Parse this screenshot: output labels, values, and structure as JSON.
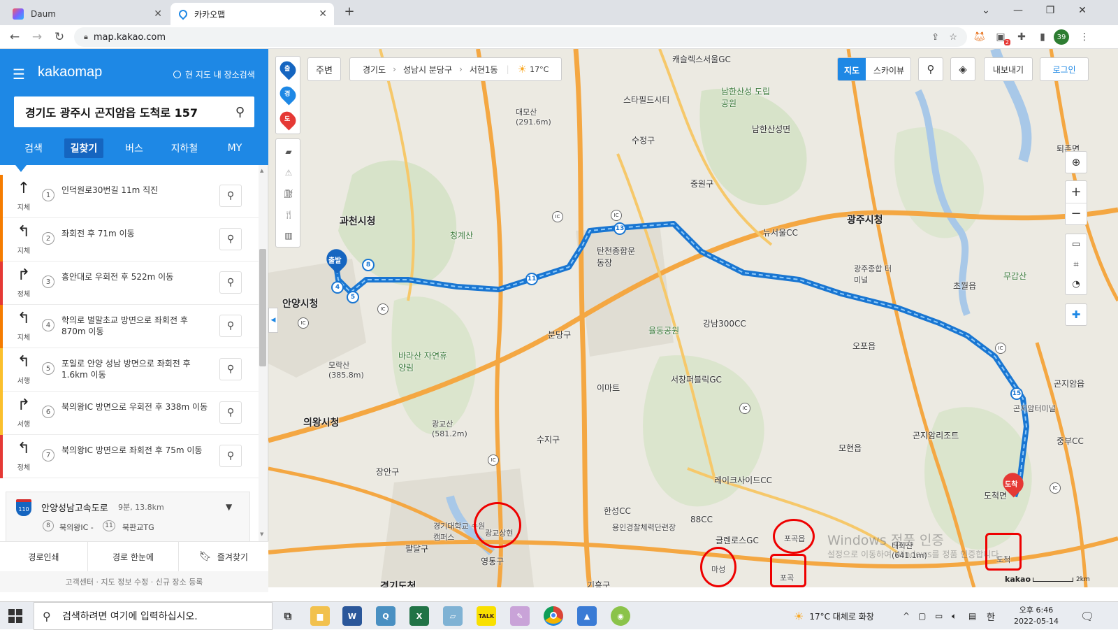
{
  "browser": {
    "tabs": [
      {
        "title": "Daum",
        "favicon_color": "#7b61ff"
      },
      {
        "title": "카카오맵",
        "favicon_color": "#1e88e5"
      }
    ],
    "new_tab": "+",
    "url": "map.kakao.com",
    "profile_initials": "39",
    "notification_count": "2"
  },
  "sidebar": {
    "brand": "kakaomap",
    "area_search_label": "현 지도 내 장소검색",
    "search_value": "경기도 광주시 곤지암읍 도척로 157",
    "tabs": [
      "검색",
      "길찾기",
      "버스",
      "지하철",
      "MY"
    ],
    "active_tab": "길찾기",
    "steps": [
      {
        "num": "1",
        "desc": "인덕원로30번길 11m 직진",
        "cond": "지체",
        "arrow": "↑",
        "color": "#f57c00"
      },
      {
        "num": "2",
        "desc": "좌회전 후 71m 이동",
        "cond": "지체",
        "arrow": "↰",
        "color": "#f57c00"
      },
      {
        "num": "3",
        "desc": "흥안대로 우회전 후 522m 이동",
        "cond": "정체",
        "arrow": "↱",
        "color": "#e53935"
      },
      {
        "num": "4",
        "desc": "학의로 벌말초교 방면으로 좌회전 후 870m 이동",
        "cond": "지체",
        "arrow": "↰",
        "color": "#f57c00"
      },
      {
        "num": "5",
        "desc": "포일로 안양 성남 방면으로 좌회전 후 1.6km 이동",
        "cond": "서행",
        "arrow": "↰",
        "color": "#fbc02d"
      },
      {
        "num": "6",
        "desc": "북의왕IC 방면으로 우회전 후 338m 이동",
        "cond": "서행",
        "arrow": "↱",
        "color": "#fbc02d"
      },
      {
        "num": "7",
        "desc": "북의왕IC 방면으로 좌회전 후 75m 이동",
        "cond": "정체",
        "arrow": "↰",
        "color": "#e53935"
      }
    ],
    "highway": {
      "shield": "110",
      "name": "안양성남고속도로",
      "info": "9분, 13.8km",
      "from_num": "8",
      "from": "북의왕IC -",
      "to_num": "11",
      "to": "북판교TG"
    },
    "footer_buttons": [
      "경로인쇄",
      "경로 한눈에",
      "즐겨찾기"
    ],
    "footer_links": "고객센터 · 지도 정보 수정 · 신규 장소 등록"
  },
  "map": {
    "around_btn": "주변",
    "breadcrumb": [
      "경기도",
      "성남시 분당구",
      "서현1동"
    ],
    "weather": "17°C",
    "map_type": [
      "지도",
      "스카이뷰"
    ],
    "export_btn": "내보내기",
    "login_btn": "로그인",
    "side_tools": [
      "출",
      "경",
      "도"
    ],
    "labels": [
      {
        "text": "과천시청",
        "kind": "big"
      },
      {
        "text": "안양시청",
        "kind": "big"
      },
      {
        "text": "의왕시청",
        "kind": "big"
      },
      {
        "text": "광주시청",
        "kind": "big"
      },
      {
        "text": "탄천종합운동장",
        "kind": "normal"
      },
      {
        "text": "분당구",
        "kind": "normal"
      },
      {
        "text": "수지구",
        "kind": "normal"
      },
      {
        "text": "중원구",
        "kind": "normal"
      },
      {
        "text": "수정구",
        "kind": "normal"
      },
      {
        "text": "남한산성 도립공원",
        "kind": "green"
      },
      {
        "text": "남한산성면",
        "kind": "normal"
      },
      {
        "text": "퇴촌면",
        "kind": "normal"
      },
      {
        "text": "초월읍",
        "kind": "normal"
      },
      {
        "text": "오포읍",
        "kind": "normal"
      },
      {
        "text": "도척면",
        "kind": "normal"
      },
      {
        "text": "곤지암읍",
        "kind": "normal"
      },
      {
        "text": "포곡읍",
        "kind": "normal"
      },
      {
        "text": "광교상현",
        "kind": "small"
      },
      {
        "text": "마성",
        "kind": "small"
      },
      {
        "text": "포곡",
        "kind": "small"
      },
      {
        "text": "도척",
        "kind": "small"
      },
      {
        "text": "뉴서울CC",
        "kind": "normal"
      },
      {
        "text": "곤지암리조트",
        "kind": "normal"
      },
      {
        "text": "레이크사이드CC",
        "kind": "normal"
      },
      {
        "text": "장안구",
        "kind": "normal"
      },
      {
        "text": "영통구",
        "kind": "normal"
      },
      {
        "text": "팔달구",
        "kind": "normal"
      },
      {
        "text": "경기대학교 수원캠퍼스",
        "kind": "small"
      },
      {
        "text": "청계산",
        "kind": "green"
      },
      {
        "text": "광교산 (581.2m)",
        "kind": "small"
      },
      {
        "text": "대모산 (291.6m)",
        "kind": "small"
      },
      {
        "text": "모락산 (385.8m)",
        "kind": "small"
      },
      {
        "text": "바라산 자연휴양림",
        "kind": "green"
      },
      {
        "text": "강남300CC",
        "kind": "normal"
      },
      {
        "text": "서창퍼블릭GC",
        "kind": "normal"
      },
      {
        "text": "율동공원",
        "kind": "green"
      },
      {
        "text": "캐슬렉스서울GC",
        "kind": "normal"
      },
      {
        "text": "이마트",
        "kind": "normal"
      },
      {
        "text": "스타필드시티",
        "kind": "normal"
      },
      {
        "text": "광주종합 터미널",
        "kind": "small"
      },
      {
        "text": "곤지암터미널",
        "kind": "small"
      },
      {
        "text": "중부CC",
        "kind": "normal"
      },
      {
        "text": "무갑산",
        "kind": "green"
      },
      {
        "text": "한성CC",
        "kind": "normal"
      },
      {
        "text": "88CC",
        "kind": "normal"
      },
      {
        "text": "글렌로스GC",
        "kind": "normal"
      },
      {
        "text": "태화산 (641.1m)",
        "kind": "small"
      },
      {
        "text": "용인경찰체력단련장",
        "kind": "small"
      },
      {
        "text": "모현읍",
        "kind": "normal"
      },
      {
        "text": "기흥구",
        "kind": "normal"
      },
      {
        "text": "경기도청",
        "kind": "big"
      }
    ],
    "start_label": "출발",
    "end_label": "도착",
    "watermark_title": "Windows 정품 인증",
    "watermark_sub": "설정으로 이동하여 Windows를 정품 인증합니다.",
    "brand": "kakao",
    "scale": "2km"
  },
  "taskbar": {
    "search_placeholder": "검색하려면 여기에 입력하십시오.",
    "weather": "17°C 대체로 화창",
    "ime": "한",
    "time": "오후 6:46",
    "date": "2022-05-14"
  }
}
